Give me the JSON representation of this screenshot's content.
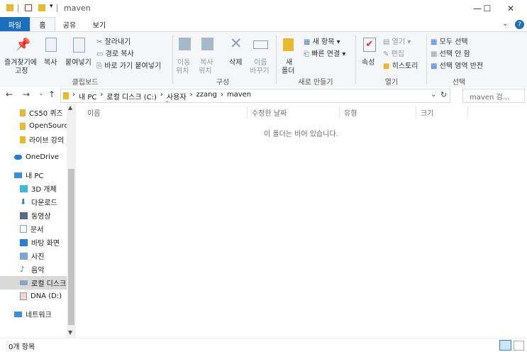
{
  "window": {
    "title": "maven",
    "controls": {
      "minimize": "—",
      "maximize": "☐",
      "close": "✕"
    }
  },
  "tabs": [
    {
      "label": "파일"
    },
    {
      "label": "홈"
    },
    {
      "label": "공유"
    },
    {
      "label": "보기"
    }
  ],
  "ribbon": {
    "clipboard": {
      "group": "클립보드",
      "pin": "즐겨찾기에",
      "pin2": "고정",
      "copy": "복사",
      "paste": "붙여넣기",
      "cut": "잘라내기",
      "copy_path": "경로 복사",
      "paste_shortcut": "바로 가기 붙여넣기"
    },
    "organize": {
      "group": "구성",
      "move": "이동",
      "move2": "위치",
      "copy_to": "복사",
      "copy_to2": "위치",
      "delete": "삭제",
      "rename": "이름",
      "rename2": "바꾸기"
    },
    "new": {
      "group": "새로 만들기",
      "new_folder": "새",
      "new_folder2": "폴더",
      "new_item": "새 항목",
      "easy_access": "빠른 연결"
    },
    "open": {
      "group": "열기",
      "properties": "속성",
      "open": "열기",
      "edit": "편집",
      "history": "히스토리"
    },
    "select": {
      "group": "선택",
      "select_all": "모두 선택",
      "select_none": "선택 안 함",
      "invert": "선택 영역 반전"
    }
  },
  "address": {
    "crumbs": [
      "내 PC",
      "로컬 디스크 (C:)",
      "사용자",
      "zzang",
      "maven"
    ],
    "search_placeholder": "maven 검..."
  },
  "nav": {
    "items": [
      {
        "label": "CS50 퀴즈"
      },
      {
        "label": "OpenSource"
      },
      {
        "label": "라이브 강의"
      },
      {
        "label": "OneDrive"
      },
      {
        "label": "내 PC"
      },
      {
        "label": "3D 개체"
      },
      {
        "label": "다운로드"
      },
      {
        "label": "동영상"
      },
      {
        "label": "문서"
      },
      {
        "label": "바탕 화면"
      },
      {
        "label": "사진"
      },
      {
        "label": "음악"
      },
      {
        "label": "로컬 디스크"
      },
      {
        "label": "DNA (D:)"
      },
      {
        "label": "네트워크"
      }
    ]
  },
  "columns": [
    {
      "label": "이름"
    },
    {
      "label": "수정한 날짜"
    },
    {
      "label": "유형"
    },
    {
      "label": "크기"
    }
  ],
  "empty_message": "이 폴더는 비어 있습니다.",
  "status": {
    "count": "0개 항목"
  }
}
